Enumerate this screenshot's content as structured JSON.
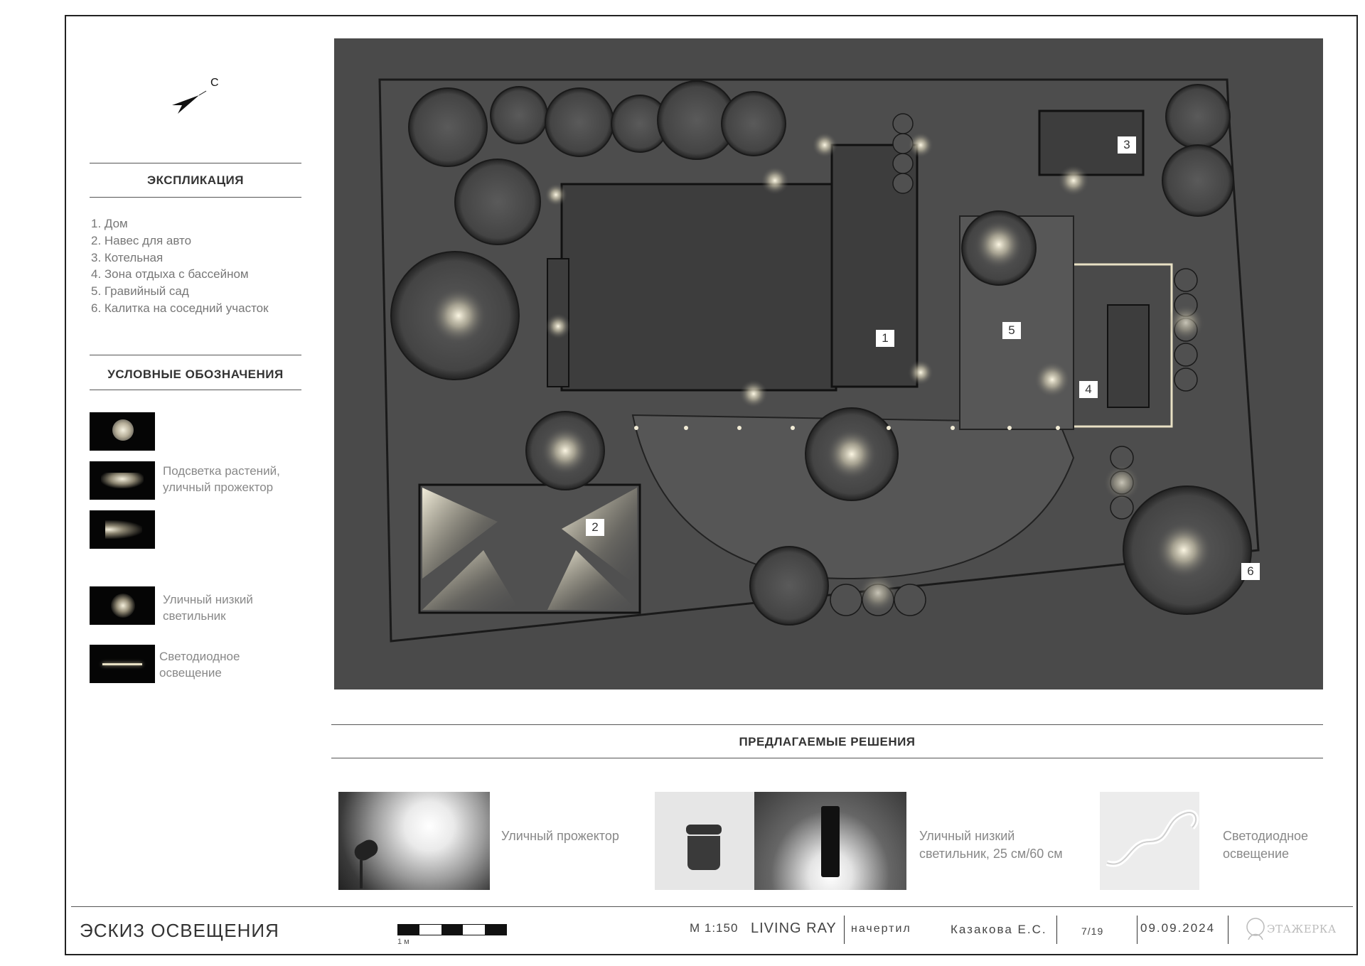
{
  "compass": {
    "north_label": "С"
  },
  "explication": {
    "title": "ЭКСПЛИКАЦИЯ",
    "items": [
      "1. Дом",
      "2. Навес для авто",
      "3. Котельная",
      "4. Зона отдыха с бассейном",
      "5. Гравийный сад",
      "6. Калитка на соседний участок"
    ]
  },
  "legend": {
    "title": "УСЛОВНЫЕ ОБОЗНАЧЕНИЯ",
    "plant_light_label_1": "Подсветка растений,",
    "plant_light_label_2": "уличный прожектор",
    "low_light_label_1": "Уличный низкий",
    "low_light_label_2": "светильник",
    "led_label_1": "Светодиодное",
    "led_label_2": "освещение"
  },
  "plan": {
    "markers": [
      "1",
      "2",
      "3",
      "4",
      "5",
      "6"
    ]
  },
  "solutions": {
    "title": "ПРЕДЛАГАЕМЫЕ РЕШЕНИЯ",
    "spot_label": "Уличный прожектор",
    "bollard_label_1": "Уличный низкий",
    "bollard_label_2": "светильник, 25 см/60 см",
    "led_label_1": "Светодиодное",
    "led_label_2": "освещение"
  },
  "footer": {
    "title": "ЭСКИЗ ОСВЕЩЕНИЯ",
    "scale_unit": "1 м",
    "scale": "М 1:150",
    "project": "LIVING RAY",
    "drawn_label": "начертил",
    "author": "Казакова Е.С.",
    "sheet": "7/19",
    "date": "09.09.2024",
    "logo_text": "ЭТАЖЕРКА"
  }
}
